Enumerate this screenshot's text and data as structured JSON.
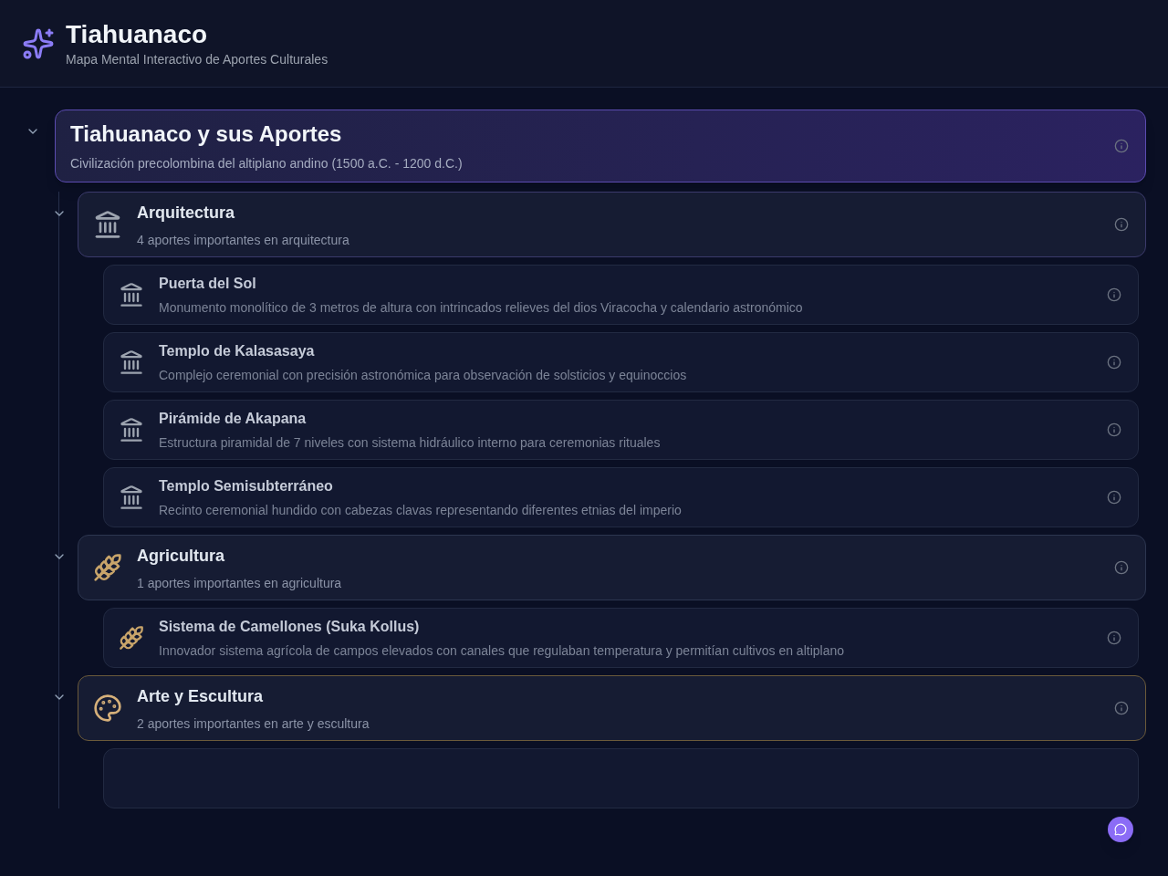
{
  "header": {
    "title": "Tiahuanaco",
    "subtitle": "Mapa Mental Interactivo de Aportes Culturales"
  },
  "root": {
    "title": "Tiahuanaco y sus Aportes",
    "subtitle": "Civilización precolombina del altiplano andino (1500 a.C. - 1200 d.C.)",
    "expanded": true
  },
  "categories": [
    {
      "kind": "architecture",
      "title": "Arquitectura",
      "subtitle": "4 aportes importantes en arquitectura",
      "expanded": true,
      "items": [
        {
          "title": "Puerta del Sol",
          "description": "Monumento monolítico de 3 metros de altura con intrincados relieves del dios Viracocha y calendario astronómico"
        },
        {
          "title": "Templo de Kalasasaya",
          "description": "Complejo ceremonial con precisión astronómica para observación de solsticios y equinoccios"
        },
        {
          "title": "Pirámide de Akapana",
          "description": "Estructura piramidal de 7 niveles con sistema hidráulico interno para ceremonias rituales"
        },
        {
          "title": "Templo Semisubterráneo",
          "description": "Recinto ceremonial hundido con cabezas clavas representando diferentes etnias del imperio"
        }
      ]
    },
    {
      "kind": "agriculture",
      "title": "Agricultura",
      "subtitle": "1 aportes importantes en agricultura",
      "expanded": true,
      "items": [
        {
          "title": "Sistema de Camellones (Suka Kollus)",
          "description": "Innovador sistema agrícola de campos elevados con canales que regulaban temperatura y permitían cultivos en altiplano"
        }
      ]
    },
    {
      "kind": "art",
      "title": "Arte y Escultura",
      "subtitle": "2 aportes importantes en arte y escultura",
      "expanded": true,
      "items_cut_off": true
    }
  ]
}
